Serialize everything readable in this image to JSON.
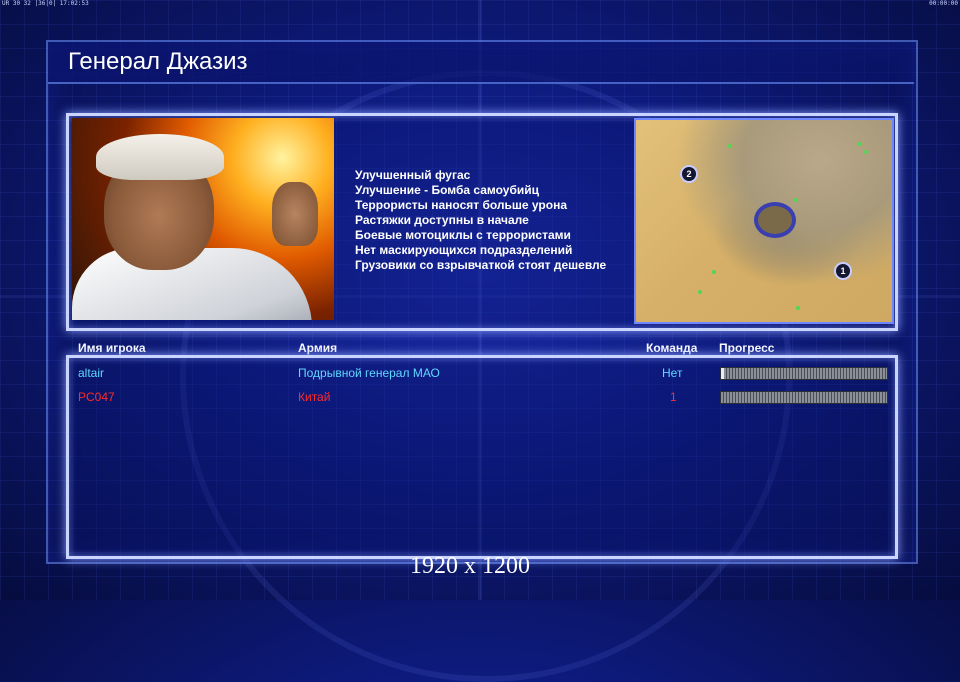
{
  "hud": {
    "top_left": "UR 30 32 |36|0| 17:02:53",
    "top_right": "00:00:00"
  },
  "title": "Генерал Джазиз",
  "bonuses": [
    "Улучшенный фугас",
    "Улучшение - Бомба самоубийц",
    "Террористы наносят больше урона",
    "Растяжки доступны в начале",
    "Боевые мотоциклы с террористами",
    "Нет маскирующихся подразделений",
    "Грузовики со взрывчаткой стоят дешевле"
  ],
  "minimap": {
    "start_positions": [
      "1",
      "2"
    ]
  },
  "table": {
    "headers": {
      "player": "Имя игрока",
      "army": "Армия",
      "team": "Команда",
      "progress": "Прогресс"
    },
    "rows": [
      {
        "player": "altair",
        "army": "Подрывной генерал МАО",
        "team": "Нет",
        "progress": 0.02,
        "color": "#5fd8ff"
      },
      {
        "player": "PC047",
        "army": "Китай",
        "team": "1",
        "progress": 0.0,
        "color": "#ff2a2a"
      }
    ]
  },
  "resolution_label": "1920 x 1200"
}
